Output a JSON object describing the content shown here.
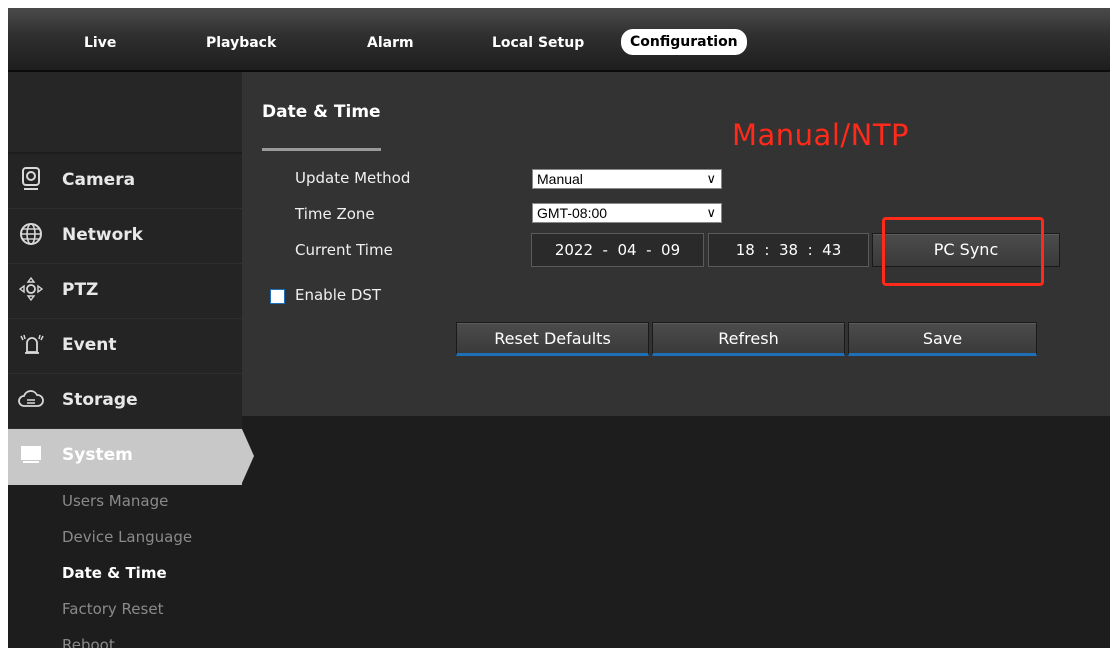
{
  "nav": {
    "items": [
      "Live",
      "Playback",
      "Alarm",
      "Local Setup",
      "Configuration"
    ],
    "active": "Configuration"
  },
  "sidebar": {
    "items": [
      {
        "label": "Camera",
        "icon": "camera-icon"
      },
      {
        "label": "Network",
        "icon": "network-globe-icon"
      },
      {
        "label": "PTZ",
        "icon": "ptz-arrows-icon"
      },
      {
        "label": "Event",
        "icon": "event-alarm-icon"
      },
      {
        "label": "Storage",
        "icon": "storage-cloud-icon"
      },
      {
        "label": "System",
        "icon": "monitor-icon"
      }
    ],
    "active_item": "System",
    "subitems": [
      "Users Manage",
      "Device Language",
      "Date & Time",
      "Factory Reset",
      "Reboot"
    ],
    "active_subitem": "Date & Time"
  },
  "page": {
    "title": "Date & Time",
    "annotation": "Manual/NTP",
    "annotation_color": "#ff2a1a"
  },
  "form": {
    "update_method_label": "Update Method",
    "update_method_value": "Manual",
    "time_zone_label": "Time Zone",
    "time_zone_value": "GMT-08:00",
    "current_time_label": "Current Time",
    "date_value": "2022  -  04  -  09",
    "time_value": "18  :  38  :  43",
    "pc_sync_label": "PC Sync",
    "enable_dst_label": "Enable DST",
    "enable_dst_checked": false
  },
  "buttons": {
    "reset_defaults": "Reset Defaults",
    "refresh": "Refresh",
    "save": "Save"
  },
  "colors": {
    "accent_blue": "#1e6fb8",
    "highlight_red": "#ff2a1a"
  }
}
